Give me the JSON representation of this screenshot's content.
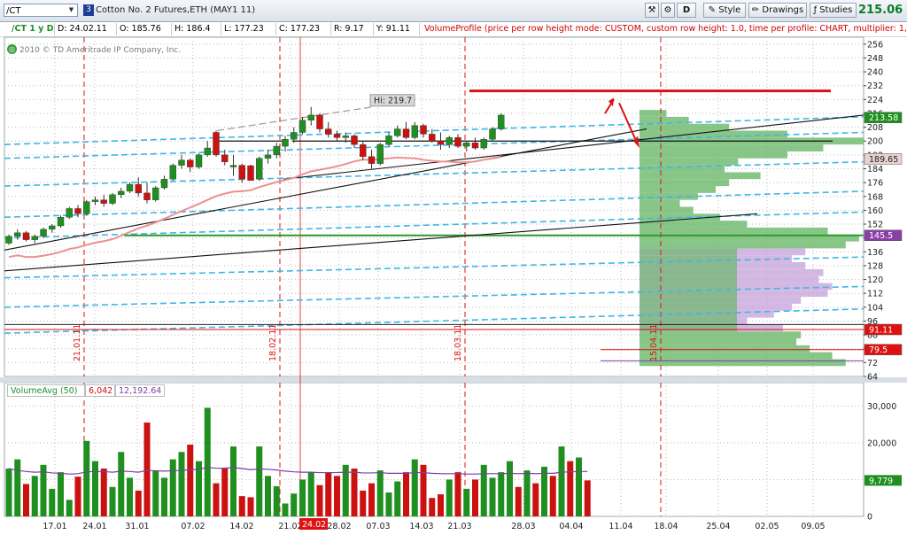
{
  "toolbar": {
    "symbol": "/CT",
    "symbol_badge": "3",
    "instrument_title": "Cotton No. 2 Futures,ETH (MAY1 11)",
    "drawing_mode_label": "D",
    "style_label": "Style",
    "drawings_label": "Drawings",
    "studies_label": "Studies",
    "last_price": "215.06"
  },
  "infobar": {
    "symbol_period": "/CT 1 y D",
    "date": "D: 24.02.11",
    "open": "O: 185.76",
    "high": "H: 186.4",
    "low": "L: 177.23",
    "close": "C: 177.23",
    "range": "R: 9.17",
    "y_value": "Y: 91.11",
    "volume_profile": "VolumeProfile (price per row height mode: CUSTOM, custom row height: 1.0, time per profile: CHART, multiplier: 1, on expa"
  },
  "copyright": "2010 © TD Ameritrade IP Company, Inc.",
  "colors": {
    "up": "#1f8f1f",
    "down": "#cc1111",
    "profile_green": "#6ab86a",
    "profile_purple": "#c9a6dd",
    "vwap_blue": "#3fb6e6",
    "ma_red": "#ee9090"
  },
  "chart_data": [
    {
      "type": "candlestick",
      "title": "",
      "ylim": [
        64,
        260
      ],
      "y_ticks": [
        64,
        72,
        80,
        88,
        96,
        104,
        112,
        120,
        128,
        136,
        144,
        152,
        160,
        168,
        176,
        184,
        192,
        200,
        208,
        216,
        224,
        232,
        240,
        248,
        256
      ],
      "x_ticks": [
        "17.01",
        "24.01",
        "31.01",
        "07.02",
        "14.02",
        "21.02",
        "28.02",
        "07.03",
        "14.03",
        "21.03",
        "28.03",
        "04.04",
        "11.04",
        "18.04",
        "25.04",
        "02.05",
        "09.05"
      ],
      "cursor_date": "24.02",
      "annotations": {
        "high_label": "Hi: 219.7",
        "vertical_markers": [
          "21.01.11",
          "18.02.11",
          "18.03.11",
          "15.04.11"
        ],
        "price_badges": [
          {
            "text": "213.58",
            "color": "#1f8f1f"
          },
          {
            "text": "189.65",
            "color": "#e8d2d2"
          },
          {
            "text": "145.5",
            "color": "#8a3fa6"
          },
          {
            "text": "91.11",
            "color": "#dd1111"
          },
          {
            "text": "79.5",
            "color": "#dd1111"
          }
        ],
        "resistance_line": 229,
        "horizontal_levels": [
          200,
          145.5,
          91.11
        ]
      },
      "candles": [
        {
          "date": "14.01",
          "o": 141,
          "h": 146,
          "l": 140,
          "c": 145
        },
        {
          "date": "17.01",
          "o": 145,
          "h": 149,
          "l": 143,
          "c": 147
        },
        {
          "date": "18.01",
          "o": 147,
          "h": 148,
          "l": 142,
          "c": 143
        },
        {
          "date": "19.01",
          "o": 143,
          "h": 146,
          "l": 141,
          "c": 145
        },
        {
          "date": "20.01",
          "o": 145,
          "h": 150,
          "l": 144,
          "c": 149
        },
        {
          "date": "21.01",
          "o": 149,
          "h": 152,
          "l": 147,
          "c": 151
        },
        {
          "date": "24.01",
          "o": 151,
          "h": 157,
          "l": 150,
          "c": 156
        },
        {
          "date": "25.01",
          "o": 156,
          "h": 162,
          "l": 155,
          "c": 161
        },
        {
          "date": "26.01",
          "o": 161,
          "h": 163,
          "l": 156,
          "c": 158
        },
        {
          "date": "27.01",
          "o": 158,
          "h": 166,
          "l": 157,
          "c": 165
        },
        {
          "date": "28.01",
          "o": 165,
          "h": 168,
          "l": 163,
          "c": 166
        },
        {
          "date": "31.01",
          "o": 166,
          "h": 169,
          "l": 162,
          "c": 164
        },
        {
          "date": "01.02",
          "o": 164,
          "h": 170,
          "l": 163,
          "c": 169
        },
        {
          "date": "02.02",
          "o": 169,
          "h": 173,
          "l": 167,
          "c": 171
        },
        {
          "date": "03.02",
          "o": 171,
          "h": 176,
          "l": 170,
          "c": 175
        },
        {
          "date": "04.02",
          "o": 175,
          "h": 179,
          "l": 168,
          "c": 170
        },
        {
          "date": "07.02",
          "o": 170,
          "h": 176,
          "l": 164,
          "c": 166
        },
        {
          "date": "08.02",
          "o": 166,
          "h": 174,
          "l": 165,
          "c": 173
        },
        {
          "date": "09.02",
          "o": 173,
          "h": 180,
          "l": 172,
          "c": 178
        },
        {
          "date": "10.02",
          "o": 178,
          "h": 187,
          "l": 177,
          "c": 186
        },
        {
          "date": "11.02",
          "o": 186,
          "h": 192,
          "l": 184,
          "c": 189
        },
        {
          "date": "14.02",
          "o": 189,
          "h": 190,
          "l": 182,
          "c": 185
        },
        {
          "date": "15.02",
          "o": 185,
          "h": 193,
          "l": 184,
          "c": 192
        },
        {
          "date": "16.02",
          "o": 192,
          "h": 200,
          "l": 191,
          "c": 196
        },
        {
          "date": "17.02",
          "o": 205,
          "h": 206,
          "l": 191,
          "c": 192
        },
        {
          "date": "18.02",
          "o": 192,
          "h": 195,
          "l": 186,
          "c": 188
        },
        {
          "date": "22.02",
          "o": 185,
          "h": 192,
          "l": 180,
          "c": 186
        },
        {
          "date": "23.02",
          "o": 186,
          "h": 187,
          "l": 176,
          "c": 178
        },
        {
          "date": "24.02",
          "o": 185.76,
          "h": 186.4,
          "l": 177.23,
          "c": 177.23
        },
        {
          "date": "25.02",
          "o": 178,
          "h": 191,
          "l": 177,
          "c": 190
        },
        {
          "date": "28.02",
          "o": 190,
          "h": 195,
          "l": 187,
          "c": 192
        },
        {
          "date": "01.03",
          "o": 192,
          "h": 199,
          "l": 190,
          "c": 197
        },
        {
          "date": "02.03",
          "o": 197,
          "h": 203,
          "l": 194,
          "c": 201
        },
        {
          "date": "03.03",
          "o": 201,
          "h": 208,
          "l": 199,
          "c": 205
        },
        {
          "date": "04.03",
          "o": 205,
          "h": 214,
          "l": 204,
          "c": 212
        },
        {
          "date": "07.03",
          "o": 212,
          "h": 219.7,
          "l": 209,
          "c": 215
        },
        {
          "date": "08.03",
          "o": 215,
          "h": 216,
          "l": 205,
          "c": 207
        },
        {
          "date": "09.03",
          "o": 207,
          "h": 211,
          "l": 202,
          "c": 204
        },
        {
          "date": "10.03",
          "o": 204,
          "h": 206,
          "l": 200,
          "c": 202
        },
        {
          "date": "11.03",
          "o": 202,
          "h": 205,
          "l": 199,
          "c": 203
        },
        {
          "date": "14.03",
          "o": 203,
          "h": 204,
          "l": 196,
          "c": 198
        },
        {
          "date": "15.03",
          "o": 198,
          "h": 200,
          "l": 189,
          "c": 191
        },
        {
          "date": "16.03",
          "o": 191,
          "h": 195,
          "l": 184,
          "c": 187
        },
        {
          "date": "17.03",
          "o": 187,
          "h": 199,
          "l": 186,
          "c": 198
        },
        {
          "date": "18.03",
          "o": 198,
          "h": 205,
          "l": 197,
          "c": 203
        },
        {
          "date": "21.03",
          "o": 203,
          "h": 209,
          "l": 202,
          "c": 207
        },
        {
          "date": "22.03",
          "o": 207,
          "h": 211,
          "l": 201,
          "c": 202
        },
        {
          "date": "23.03",
          "o": 202,
          "h": 211,
          "l": 201,
          "c": 209
        },
        {
          "date": "24.03",
          "o": 209,
          "h": 210,
          "l": 202,
          "c": 204
        },
        {
          "date": "25.03",
          "o": 204,
          "h": 207,
          "l": 199,
          "c": 200
        },
        {
          "date": "28.03",
          "o": 200,
          "h": 205,
          "l": 195,
          "c": 198
        },
        {
          "date": "29.03",
          "o": 198,
          "h": 203,
          "l": 196,
          "c": 202
        },
        {
          "date": "30.03",
          "o": 202,
          "h": 204,
          "l": 196,
          "c": 197
        },
        {
          "date": "31.03",
          "o": 197,
          "h": 200,
          "l": 194,
          "c": 199
        },
        {
          "date": "01.04",
          "o": 199,
          "h": 202,
          "l": 195,
          "c": 196
        },
        {
          "date": "04.04",
          "o": 196,
          "h": 202,
          "l": 195,
          "c": 201
        },
        {
          "date": "05.04",
          "o": 201,
          "h": 208,
          "l": 200,
          "c": 207
        },
        {
          "date": "06.04",
          "o": 207,
          "h": 216,
          "l": 206,
          "c": 215
        }
      ],
      "volume_profile": {
        "rows_price": [
          72,
          76,
          80,
          84,
          88,
          92,
          96,
          100,
          104,
          108,
          112,
          116,
          120,
          124,
          128,
          132,
          136,
          140,
          144,
          148,
          152,
          156,
          160,
          164,
          168,
          172,
          176,
          180,
          184,
          188,
          192,
          196,
          200,
          204,
          208,
          212,
          216
        ],
        "rows_volume": [
          92,
          86,
          76,
          70,
          72,
          64,
          48,
          60,
          68,
          72,
          84,
          86,
          80,
          82,
          74,
          68,
          74,
          92,
          98,
          84,
          48,
          36,
          24,
          18,
          26,
          34,
          40,
          54,
          38,
          44,
          66,
          82,
          100,
          66,
          40,
          22,
          12
        ]
      }
    },
    {
      "type": "bar",
      "title": "VolumeAvg (50)",
      "values_label": "6,042",
      "avg_label": "12,192.64",
      "right_badge": "9,779",
      "ylim": [
        0,
        32000
      ],
      "y_ticks": [
        0,
        10000,
        20000,
        30000
      ],
      "y_tick_labels": [
        "0",
        "10,000",
        "20,000",
        "30,000"
      ],
      "values": [
        13000,
        15500,
        8800,
        11000,
        14000,
        7500,
        12000,
        4500,
        10800,
        20500,
        15000,
        13000,
        8000,
        17500,
        10500,
        7000,
        25500,
        12500,
        10500,
        15500,
        17500,
        19500,
        15000,
        29500,
        9000,
        13000,
        19000,
        5500,
        5200,
        19000,
        11000,
        8200,
        3500,
        6200,
        10000,
        12000,
        8500,
        12000,
        11000,
        14000,
        13000,
        7000,
        9000,
        12500,
        6500,
        9500,
        12000,
        15500,
        14000,
        5000,
        6000,
        10000,
        12000,
        7500,
        10000,
        14000,
        10500,
        12000,
        15000,
        8000,
        12500,
        9000,
        13500,
        11000,
        19000,
        15000,
        16000,
        9779
      ],
      "avg_values": [
        13000,
        12500,
        12200,
        12000,
        12100,
        11800,
        11700,
        11500,
        11600,
        12100,
        12200,
        12200,
        12000,
        12300,
        12200,
        12000,
        12500,
        12400,
        12300,
        12400,
        12500,
        12700,
        12800,
        13300,
        13100,
        13100,
        13300,
        13000,
        12700,
        12900,
        12800,
        12600,
        12300,
        12100,
        12000,
        12000,
        11900,
        11900,
        11900,
        12000,
        12000,
        11800,
        11800,
        11900,
        11700,
        11700,
        11700,
        11900,
        11900,
        11700,
        11600,
        11600,
        11600,
        11500,
        11500,
        11600,
        11600,
        11600,
        11700,
        11600,
        11700,
        11600,
        11700,
        11700,
        12000,
        12100,
        12200,
        12192.64
      ]
    }
  ]
}
